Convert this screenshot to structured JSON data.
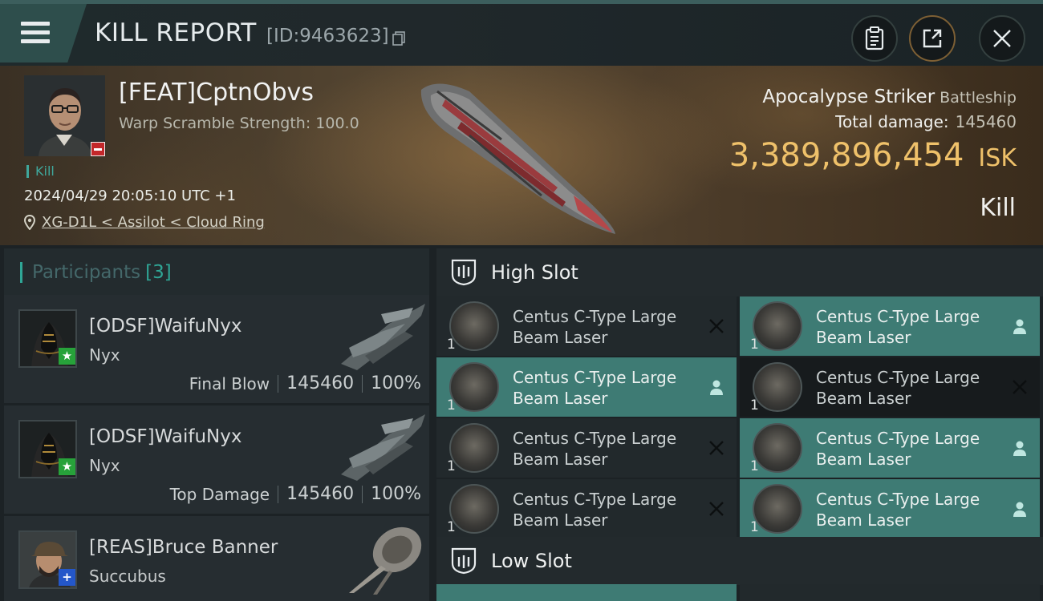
{
  "header": {
    "title": "KILL REPORT",
    "report_id": "[ID:9463623]"
  },
  "victim": {
    "name": "[FEAT]CptnObvs",
    "warp_scramble": "Warp Scramble Strength: 100.0",
    "kill_tag": "Kill",
    "timestamp": "2024/04/29 20:05:10 UTC +1",
    "location": "XG-D1L < Assilot < Cloud Ring",
    "ship_name": "Apocalypse Striker",
    "ship_class": "Battleship",
    "total_damage_label": "Total damage:",
    "total_damage": "145460",
    "isk_value": "3,389,896,454",
    "isk_unit": "ISK",
    "kill_type": "Kill"
  },
  "participants": {
    "title": "Participants",
    "count": "[3]",
    "items": [
      {
        "name": "[ODSF]WaifuNyx",
        "ship": "Nyx",
        "role": "Final Blow",
        "damage": "145460",
        "percent": "100%",
        "badge": "★"
      },
      {
        "name": "[ODSF]WaifuNyx",
        "ship": "Nyx",
        "role": "Top Damage",
        "damage": "145460",
        "percent": "100%",
        "badge": "★"
      },
      {
        "name": "[REAS]Bruce Banner",
        "ship": "Succubus",
        "badge": "+"
      }
    ]
  },
  "high_slot": {
    "title": "High Slot",
    "modules": [
      {
        "qty": "1",
        "name_line1": "Centus C-Type Large",
        "name_line2": "Beam Laser",
        "state": "destroyed"
      },
      {
        "qty": "1",
        "name_line1": "Centus C-Type Large",
        "name_line2": "Beam Laser",
        "state": "dropped"
      },
      {
        "qty": "1",
        "name_line1": "Centus C-Type Large",
        "name_line2": "Beam Laser",
        "state": "dropped"
      },
      {
        "qty": "1",
        "name_line1": "Centus C-Type Large",
        "name_line2": "Beam Laser",
        "state": "destroyed"
      },
      {
        "qty": "1",
        "name_line1": "Centus C-Type Large",
        "name_line2": "Beam Laser",
        "state": "destroyed"
      },
      {
        "qty": "1",
        "name_line1": "Centus C-Type Large",
        "name_line2": "Beam Laser",
        "state": "dropped"
      },
      {
        "qty": "1",
        "name_line1": "Centus C-Type Large",
        "name_line2": "Beam Laser",
        "state": "destroyed"
      },
      {
        "qty": "1",
        "name_line1": "Centus C-Type Large",
        "name_line2": "Beam Laser",
        "state": "dropped"
      }
    ]
  },
  "low_slot": {
    "title": "Low Slot"
  },
  "icons": {
    "menu": "hamburger-icon",
    "copy": "copy-icon",
    "clipboard": "clipboard-icon",
    "share": "share-icon",
    "close": "close-icon",
    "location": "location-pin-icon",
    "slot": "slot-icon",
    "destroyed": "x-icon",
    "dropped": "person-icon"
  },
  "colors": {
    "accent_teal": "#2fa696",
    "dropped_bg": "#3e7b74",
    "isk_gold": "#efc16a",
    "loss_badge": "#c3272a"
  }
}
